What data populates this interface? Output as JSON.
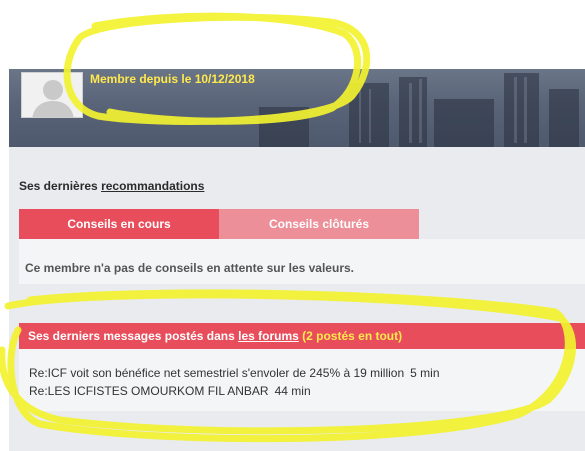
{
  "profile": {
    "member_since": "Membre depuis le 10/12/2018"
  },
  "recommendations": {
    "heading_prefix": "Ses dernières ",
    "heading_link": "recommandations",
    "tabs": [
      {
        "label": "Conseils en cours",
        "active": true
      },
      {
        "label": "Conseils clôturés",
        "active": false
      }
    ],
    "empty_message": "Ce membre n'a pas de conseils en attente sur les valeurs."
  },
  "messages": {
    "header_prefix": "Ses derniers messages postés dans ",
    "header_link": "les forums",
    "header_count": " (2 postés en tout)",
    "items": [
      {
        "title": "Re:ICF voit son bénéfice net semestriel s'envoler de 245% à 19 million",
        "age": "5 min"
      },
      {
        "title": "Re:LES ICFISTES OMOURKOM FIL ANBAR",
        "age": "44 min"
      }
    ]
  },
  "colors": {
    "accent_red": "#e84d5b",
    "tab_inactive": "#ec8f98",
    "highlight_yellow": "#ffe94d",
    "annotation_yellow": "#f2f230"
  }
}
